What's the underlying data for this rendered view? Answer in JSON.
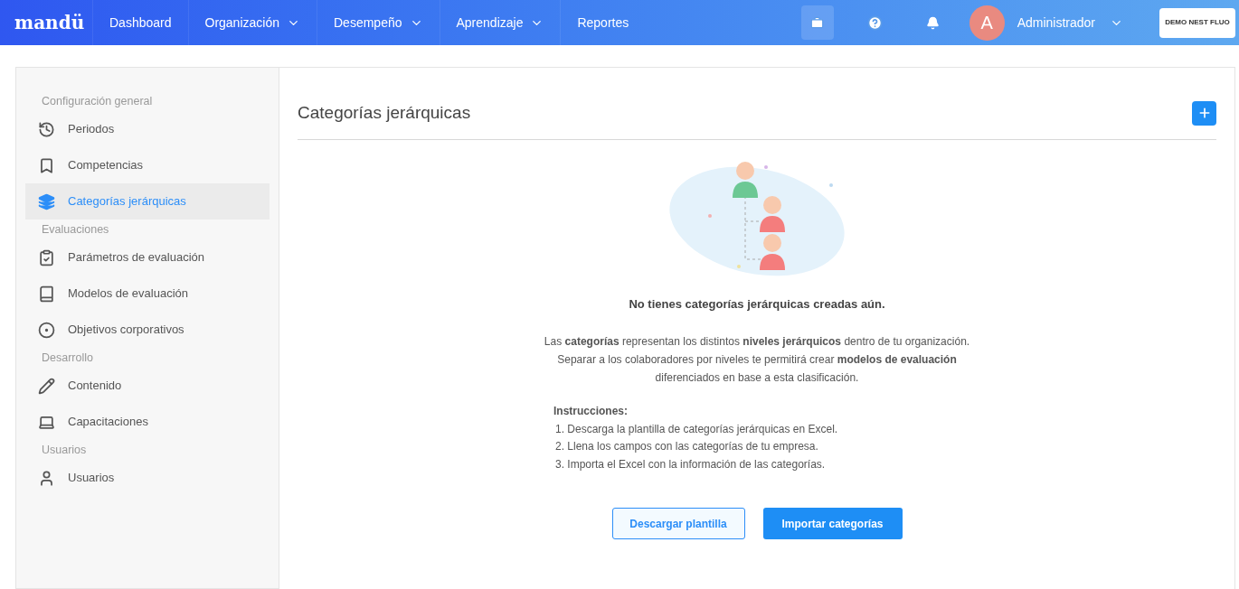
{
  "navbar": {
    "logo": "mandü",
    "menu": [
      {
        "label": "Dashboard",
        "dropdown": false
      },
      {
        "label": "Organización",
        "dropdown": true
      },
      {
        "label": "Desempeño",
        "dropdown": true
      },
      {
        "label": "Aprendizaje",
        "dropdown": true
      },
      {
        "label": "Reportes",
        "dropdown": false
      }
    ],
    "user": {
      "initial": "A",
      "name": "Administrador"
    },
    "company": "DEMO NEST FLUO"
  },
  "sidebar": {
    "sections": [
      {
        "heading": "Configuración general",
        "items": [
          {
            "label": "Periodos",
            "selected": false
          },
          {
            "label": "Competencias",
            "selected": false
          },
          {
            "label": "Categorías jerárquicas",
            "selected": true
          }
        ]
      },
      {
        "heading": "Evaluaciones",
        "items": [
          {
            "label": "Parámetros de evaluación",
            "selected": false
          },
          {
            "label": "Modelos de evaluación",
            "selected": false
          },
          {
            "label": "Objetivos corporativos",
            "selected": false
          }
        ]
      },
      {
        "heading": "Desarrollo",
        "items": [
          {
            "label": "Contenido",
            "selected": false
          },
          {
            "label": "Capacitaciones",
            "selected": false
          }
        ]
      },
      {
        "heading": "Usuarios",
        "items": [
          {
            "label": "Usuarios",
            "selected": false
          }
        ]
      }
    ]
  },
  "main": {
    "title": "Categorías jerárquicas",
    "empty_title": "No tienes categorías jerárquicas creadas aún.",
    "description": "Las **categorías** representan los distintos **niveles jerárquicos** dentro de tu organización. Separar a los colaboradores por niveles te permitirá crear **modelos de evaluación** diferenciados en base a esta clasificación.",
    "instructions_heading": "Instrucciones:",
    "instructions": [
      "1. Descarga la plantilla de categorías jerárquicas en Excel.",
      "2. Llena los campos con las categorías de tu empresa.",
      "3. Importa el Excel con la información de las categorías."
    ],
    "buttons": [
      {
        "label": "Descargar plantilla",
        "kind": "outline"
      },
      {
        "label": "Importar categorías",
        "kind": "primary"
      }
    ]
  }
}
